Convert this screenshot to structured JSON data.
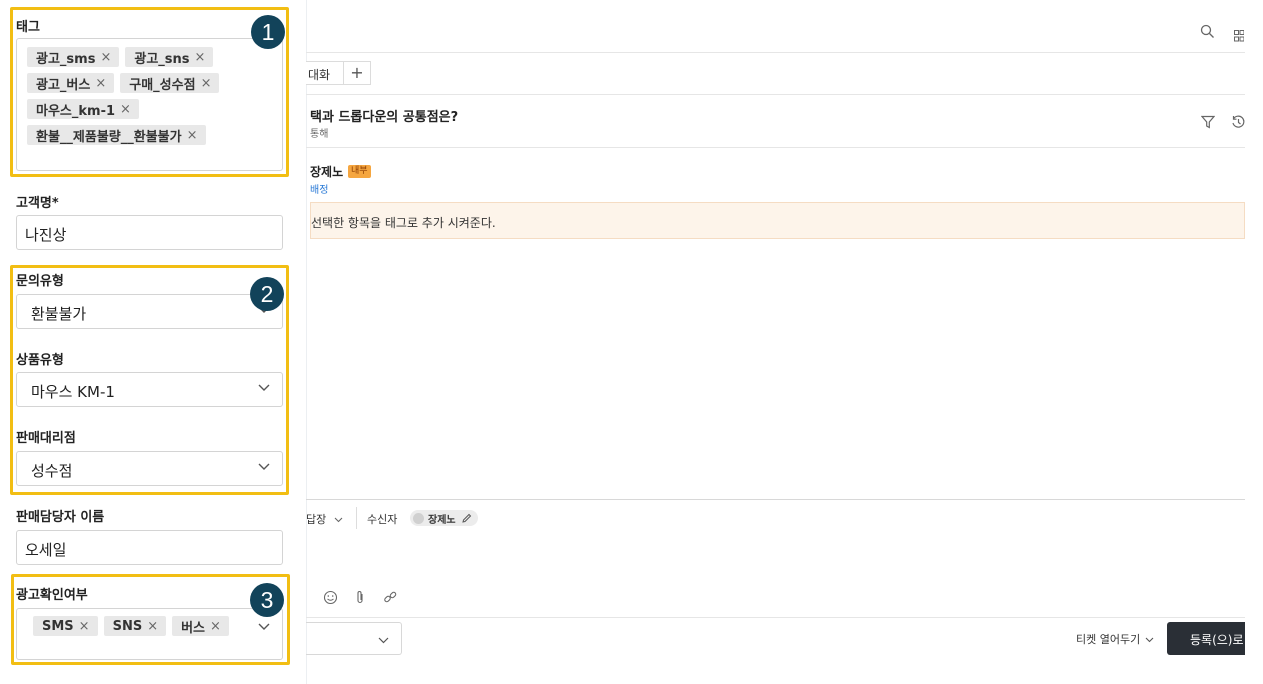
{
  "left_panel": {
    "tags": {
      "label": "태그",
      "rows": [
        [
          "광고_sms",
          "광고_sns"
        ],
        [
          "광고_버스",
          "구매_성수점"
        ],
        [
          "마우스_km-1"
        ],
        [
          "환불__제품불량__환불불가"
        ]
      ]
    },
    "customer_name": {
      "label": "고객명*",
      "value": "나진상"
    },
    "inquiry_type": {
      "label": "문의유형",
      "value": "환불불가"
    },
    "product_type": {
      "label": "상품유형",
      "value": "마우스 KM-1"
    },
    "dealer": {
      "label": "판매대리점",
      "value": "성수점"
    },
    "sales_rep": {
      "label": "판매담당자 이름",
      "value": "오세일"
    },
    "ad_check": {
      "label": "광고확인여부",
      "chips": [
        "SMS",
        "SNS",
        "버스"
      ]
    },
    "chip_remove_glyph": "×",
    "badges": [
      "1",
      "2",
      "3"
    ],
    "highlight_color": "#f2be13",
    "badge_color": "#12435a"
  },
  "main_panel": {
    "tab_label": "대화",
    "add_tab_glyph": "+",
    "ticket_title": "택과 드롭다운의 공통점은?",
    "ticket_channel": "통해",
    "message": {
      "author": "장제노",
      "internal_badge": "내부",
      "sub_label": "배정",
      "body": "선택한 항목을 태그로 추가 시켜준다."
    },
    "composer": {
      "reply_mode": "답장",
      "recipient_label": "수신자",
      "recipient_name": "장제노"
    },
    "footer": {
      "status_select": "티켓 열어두기",
      "submit_label": "등록(으)로"
    },
    "icons": [
      "search-icon",
      "apps-icon",
      "filter-icon",
      "history-icon",
      "emoji-icon",
      "attach-icon",
      "link-icon",
      "edit-icon"
    ]
  }
}
